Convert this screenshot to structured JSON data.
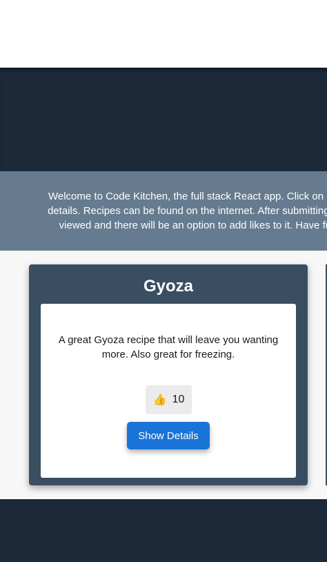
{
  "intro": {
    "text": "Welcome to Code Kitchen, the full stack React app. Click on a recipe to see more details. Recipes can be found on the internet. After submitting the review it can be viewed and there will be an option to add likes to it. Have fun adding recipes!"
  },
  "card": {
    "title": "Gyoza",
    "description": "A great Gyoza recipe that will leave you wanting more. Also great for freezing.",
    "like_icon": "👍",
    "likes": "10",
    "details_label": "Show Details"
  },
  "colors": {
    "header": "#1b2938",
    "intro_bg": "#667b8f",
    "card_bg": "#3a4e62",
    "button_blue": "#1a73d6"
  }
}
